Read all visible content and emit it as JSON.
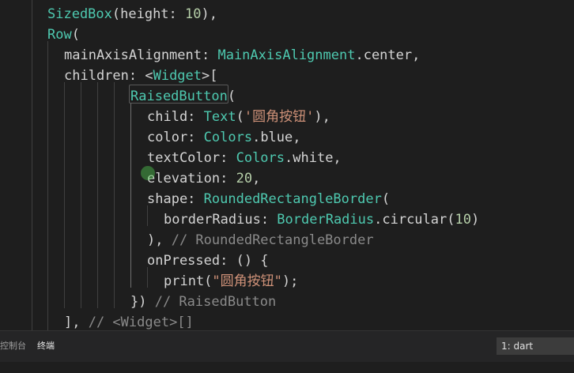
{
  "code_lines": [
    {
      "segments": [
        {
          "text": "SizedBox",
          "cls": "tok-class"
        },
        {
          "text": "(height: ",
          "cls": "tok-plain"
        },
        {
          "text": "10",
          "cls": "tok-num"
        },
        {
          "text": "),",
          "cls": "tok-plain"
        }
      ]
    },
    {
      "segments": [
        {
          "text": "Row",
          "cls": "tok-class"
        },
        {
          "text": "(",
          "cls": "tok-plain"
        }
      ]
    },
    {
      "segments": [
        {
          "text": "mainAxisAlignment: ",
          "cls": "tok-plain"
        },
        {
          "text": "MainAxisAlignment",
          "cls": "tok-class"
        },
        {
          "text": ".center,",
          "cls": "tok-plain"
        }
      ]
    },
    {
      "segments": [
        {
          "text": "children: <",
          "cls": "tok-plain"
        },
        {
          "text": "Widget",
          "cls": "tok-class"
        },
        {
          "text": ">[",
          "cls": "tok-plain"
        }
      ]
    },
    {
      "segments": [
        {
          "text": "RaisedButton",
          "cls": "tok-class"
        },
        {
          "text": "(",
          "cls": "tok-plain"
        }
      ]
    },
    {
      "segments": [
        {
          "text": "child: ",
          "cls": "tok-plain"
        },
        {
          "text": "Text",
          "cls": "tok-class"
        },
        {
          "text": "(",
          "cls": "tok-plain"
        },
        {
          "text": "'圆角按钮'",
          "cls": "tok-string"
        },
        {
          "text": "),",
          "cls": "tok-plain"
        }
      ]
    },
    {
      "segments": [
        {
          "text": "color: ",
          "cls": "tok-plain"
        },
        {
          "text": "Colors",
          "cls": "tok-class"
        },
        {
          "text": ".blue,",
          "cls": "tok-plain"
        }
      ]
    },
    {
      "segments": [
        {
          "text": "textColor: ",
          "cls": "tok-plain"
        },
        {
          "text": "Colors",
          "cls": "tok-class"
        },
        {
          "text": ".white,",
          "cls": "tok-plain"
        }
      ]
    },
    {
      "segments": [
        {
          "text": "elevation: ",
          "cls": "tok-plain"
        },
        {
          "text": "20",
          "cls": "tok-num"
        },
        {
          "text": ",",
          "cls": "tok-plain"
        }
      ]
    },
    {
      "segments": [
        {
          "text": "shape: ",
          "cls": "tok-plain"
        },
        {
          "text": "RoundedRectangleBorder",
          "cls": "tok-class"
        },
        {
          "text": "(",
          "cls": "tok-plain"
        }
      ]
    },
    {
      "segments": [
        {
          "text": "borderRadius: ",
          "cls": "tok-plain"
        },
        {
          "text": "BorderRadius",
          "cls": "tok-class"
        },
        {
          "text": ".circular(",
          "cls": "tok-plain"
        },
        {
          "text": "10",
          "cls": "tok-num"
        },
        {
          "text": ")",
          "cls": "tok-plain"
        }
      ]
    },
    {
      "segments": [
        {
          "text": "), ",
          "cls": "tok-plain"
        },
        {
          "text": "// RoundedRectangleBorder",
          "cls": "tok-comment-gray"
        }
      ]
    },
    {
      "segments": [
        {
          "text": "onPressed: () {",
          "cls": "tok-plain"
        }
      ]
    },
    {
      "segments": [
        {
          "text": "print(",
          "cls": "tok-plain"
        },
        {
          "text": "\"圆角按钮\"",
          "cls": "tok-string"
        },
        {
          "text": ");",
          "cls": "tok-plain"
        }
      ]
    },
    {
      "segments": [
        {
          "text": "}) ",
          "cls": "tok-plain"
        },
        {
          "text": "// RaisedButton",
          "cls": "tok-comment-gray"
        }
      ]
    },
    {
      "segments": [
        {
          "text": "], ",
          "cls": "tok-plain"
        },
        {
          "text": "// <Widget>[]",
          "cls": "tok-comment-gray"
        }
      ]
    }
  ],
  "panel": {
    "tabs": [
      {
        "label": "控制台"
      },
      {
        "label": "终端"
      }
    ],
    "terminal_select": "1: dart"
  },
  "colors": {
    "background": "#1e1e1e",
    "class": "#4ec9b0",
    "string": "#ce9178",
    "number": "#b5cea8"
  }
}
